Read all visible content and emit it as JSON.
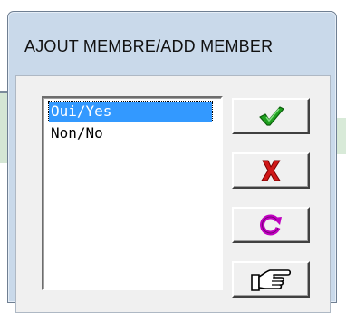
{
  "dialog": {
    "title": "AJOUT MEMBRE/ADD MEMBER"
  },
  "list": {
    "items": [
      {
        "label": "Oui/Yes",
        "selected": true
      },
      {
        "label": "Non/No",
        "selected": false
      }
    ]
  },
  "buttons": [
    {
      "name": "ok-button",
      "icon": "checkmark-icon",
      "color": "#1fa01f"
    },
    {
      "name": "cancel-button",
      "icon": "red-x-icon",
      "color": "#d01818"
    },
    {
      "name": "refresh-button",
      "icon": "refresh-arrow-icon",
      "color": "#c000c0"
    },
    {
      "name": "help-button",
      "icon": "pointing-hand-icon",
      "color": "#000000"
    }
  ],
  "colors": {
    "dialog_frame": "#c9d9ea",
    "client_bg": "#f0f0f0",
    "selection": "#3399ff"
  }
}
